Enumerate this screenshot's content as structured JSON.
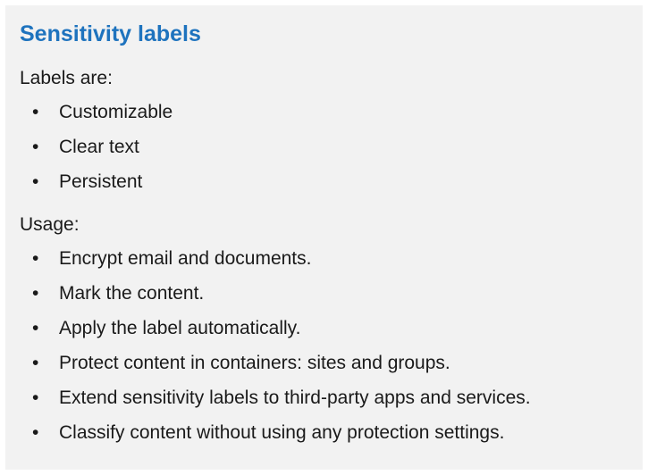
{
  "title": "Sensitivity labels",
  "labels_section": {
    "heading": "Labels are:",
    "items": [
      "Customizable",
      "Clear text",
      "Persistent"
    ]
  },
  "usage_section": {
    "heading": "Usage:",
    "items": [
      "Encrypt email and documents.",
      "Mark the content.",
      "Apply the label automatically.",
      "Protect content in containers: sites and groups.",
      "Extend sensitivity labels to third-party apps and services.",
      "Classify content without using any protection settings."
    ]
  },
  "bullet_glyph": "•",
  "colors": {
    "title": "#1e73be",
    "panel_background": "#f2f2f2",
    "text": "#1a1a1a"
  }
}
